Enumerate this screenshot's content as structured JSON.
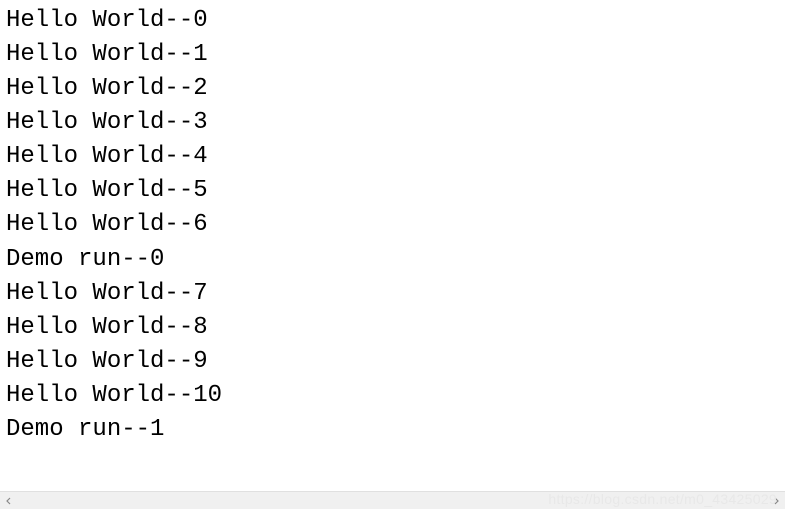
{
  "console": {
    "lines": [
      "Hello World--0",
      "Hello World--1",
      "Hello World--2",
      "Hello World--3",
      "Hello World--4",
      "Hello World--5",
      "Hello World--6",
      "Demo run--0",
      "Hello World--7",
      "Hello World--8",
      "Hello World--9",
      "Hello World--10",
      "Demo run--1"
    ]
  },
  "watermark": "https://blog.csdn.net/m0_43425029"
}
